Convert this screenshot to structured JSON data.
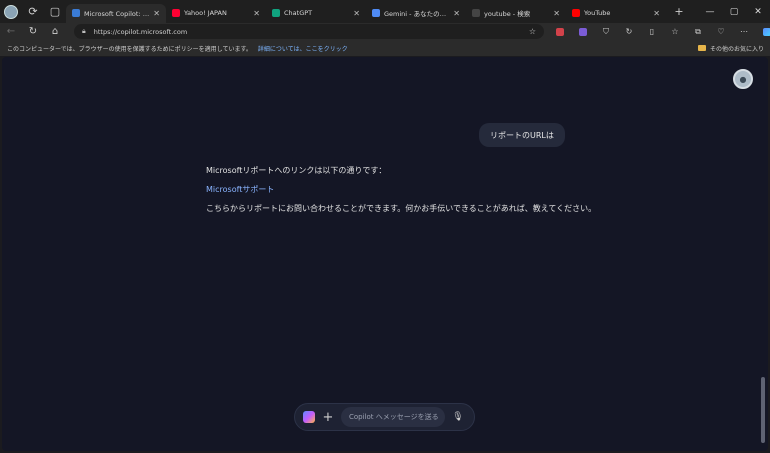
{
  "browser": {
    "tabs": [
      {
        "label": "Microsoft Copilot: あなたの AI",
        "color": "#3a7bd5",
        "active": true
      },
      {
        "label": "Yahoo! JAPAN",
        "color": "#ff0033",
        "active": false
      },
      {
        "label": "ChatGPT",
        "color": "#10a37f",
        "active": false
      },
      {
        "label": "Gemini - あなたの日常を支援する AI",
        "color": "#4f8bf5",
        "active": false
      },
      {
        "label": "youtube - 検索",
        "color": "#444444",
        "active": false
      },
      {
        "label": "YouTube",
        "color": "#ff0000",
        "active": false
      }
    ],
    "url": "https://copilot.microsoft.com",
    "infobar_text": "このコンピューターでは、ブラウザーの使用を保護するためにポリシーを適用しています。",
    "infobar_link": "詳細については、ここをクリック",
    "favorites_label": "その他のお気に入り"
  },
  "chat": {
    "user_message": "リポートのURLは",
    "reply_line1": "Microsoftリポートへのリンクは以下の通りです：",
    "reply_link": "Microsoftサポート",
    "reply_line3": "こちらからリポートにお問い合わせることができます。何かお手伝いできることがあれば、教えてください。"
  },
  "composer": {
    "placeholder": "Copilot へメッセージを送る"
  }
}
